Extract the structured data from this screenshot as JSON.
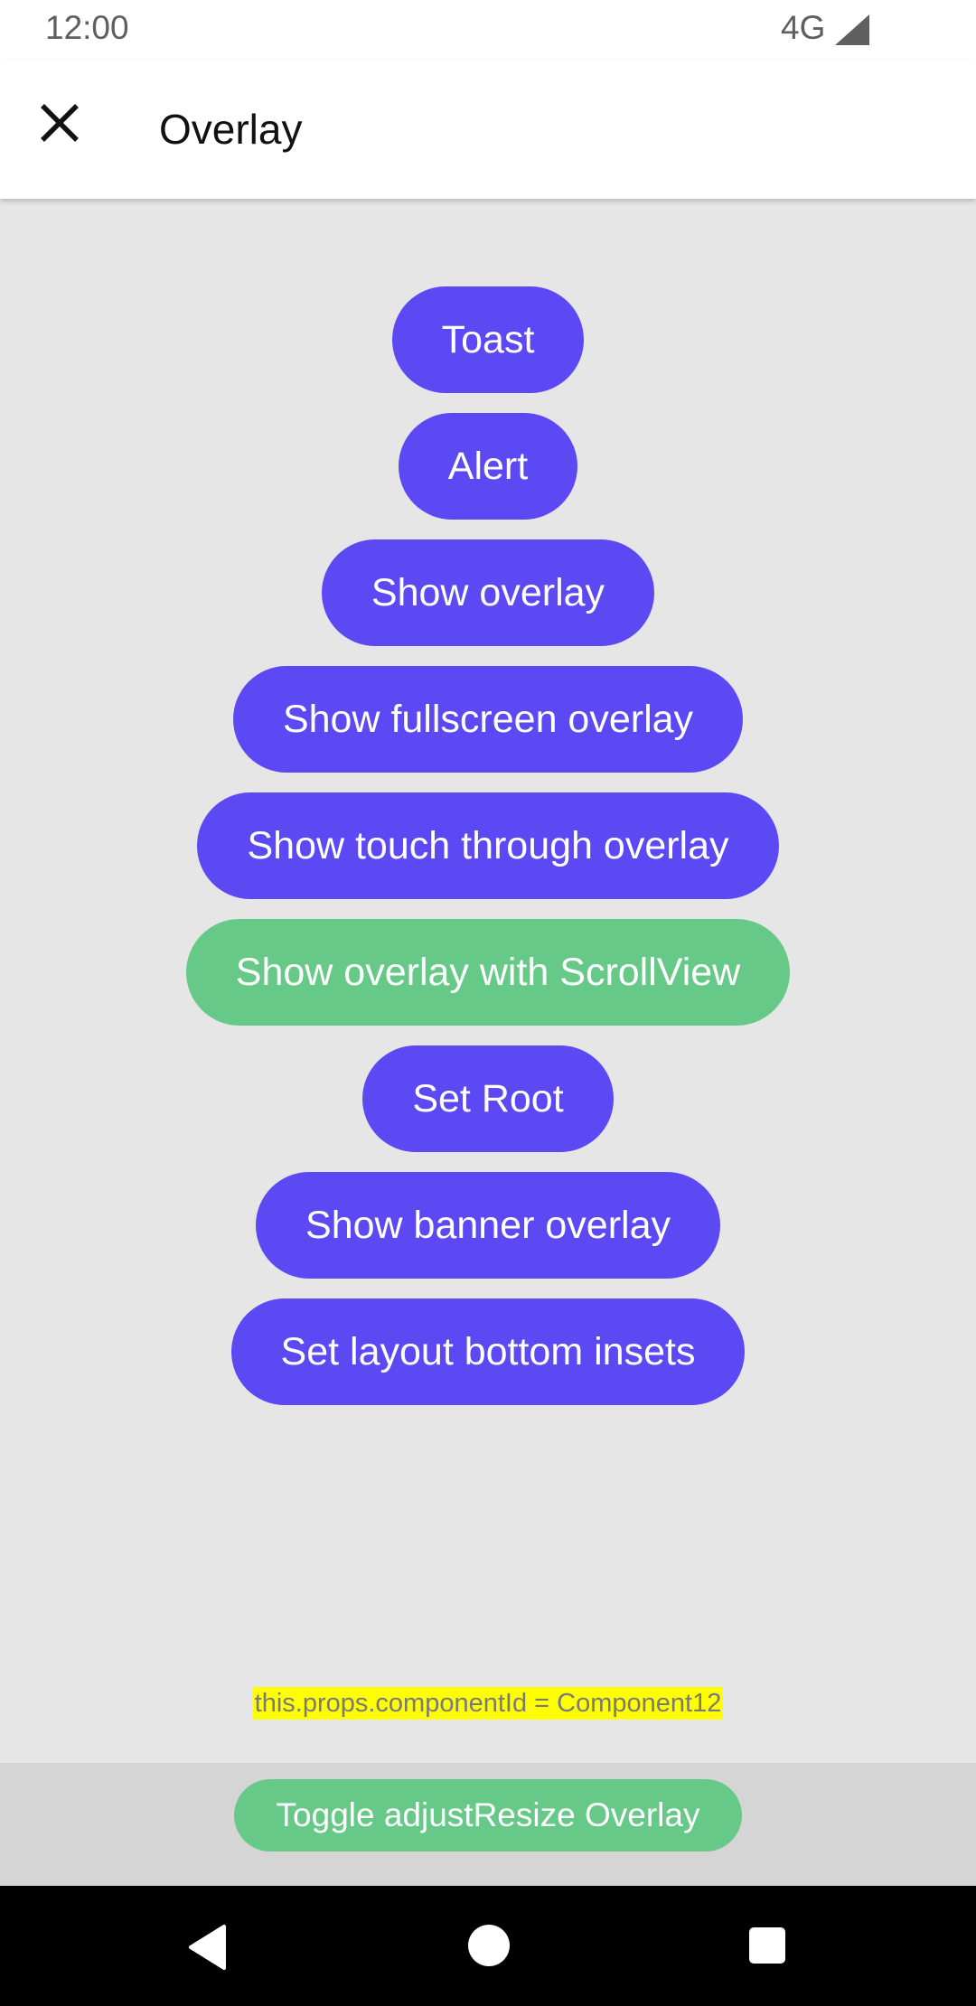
{
  "status_bar": {
    "time": "12:00",
    "network": "4G",
    "signal_icon": "cell-signal-icon"
  },
  "toolbar": {
    "close_icon": "close-icon",
    "title": "Overlay"
  },
  "buttons": [
    {
      "label": "Toast",
      "color": "#5c49f3"
    },
    {
      "label": "Alert",
      "color": "#5c49f3"
    },
    {
      "label": "Show overlay",
      "color": "#5c49f3"
    },
    {
      "label": "Show fullscreen overlay",
      "color": "#5c49f3"
    },
    {
      "label": "Show touch through overlay",
      "color": "#5c49f3"
    },
    {
      "label": "Show overlay with ScrollView",
      "color": "#67c987"
    },
    {
      "label": "Set Root",
      "color": "#5c49f3"
    },
    {
      "label": "Show banner overlay",
      "color": "#5c49f3"
    },
    {
      "label": "Set layout bottom insets",
      "color": "#5c49f3"
    }
  ],
  "component_id_text": "this.props.componentId = Component12",
  "bottom": {
    "toggle_label": "Toggle adjustResize Overlay"
  },
  "nav_bar": {
    "back_icon": "back-triangle-icon",
    "home_icon": "home-circle-icon",
    "recents_icon": "recents-square-icon"
  },
  "colors": {
    "primary": "#5c49f3",
    "accent_green": "#67c987",
    "background": "#e6e6e6",
    "highlight": "#ffff00"
  }
}
